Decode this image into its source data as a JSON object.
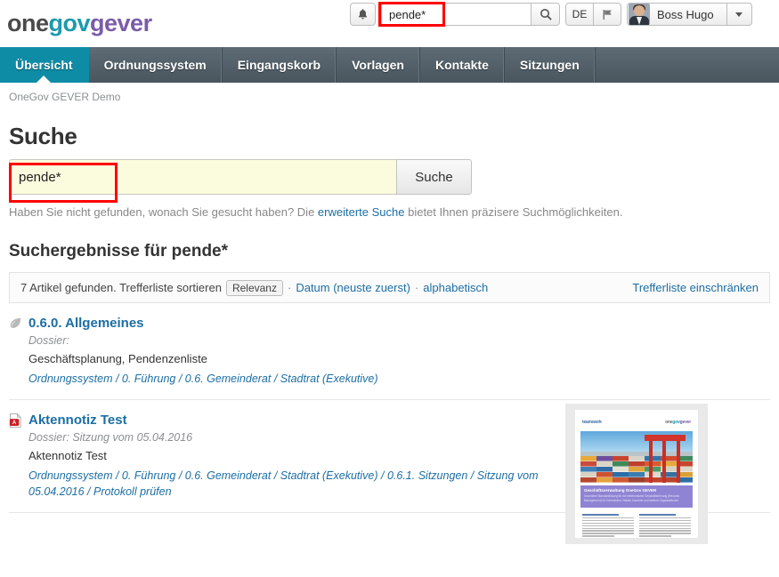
{
  "header": {
    "logo": {
      "part1": "one",
      "part2": "gov",
      "part3": "gever"
    },
    "notifications_icon": "bell-icon",
    "search": {
      "value": "pende*",
      "placeholder": "",
      "button_icon": "search-icon"
    },
    "language": "DE",
    "flag_icon": "flag-icon",
    "user": {
      "name": "Boss Hugo",
      "avatar": "user-avatar"
    },
    "dropdown_icon": "chevron-down-icon"
  },
  "nav": {
    "items": [
      {
        "label": "Übersicht",
        "active": true
      },
      {
        "label": "Ordnungssystem",
        "active": false
      },
      {
        "label": "Eingangskorb",
        "active": false
      },
      {
        "label": "Vorlagen",
        "active": false
      },
      {
        "label": "Kontakte",
        "active": false
      },
      {
        "label": "Sitzungen",
        "active": false
      }
    ]
  },
  "breadcrumb": "OneGov GEVER Demo",
  "main": {
    "page_title": "Suche",
    "search": {
      "value": "pende*",
      "placeholder": "",
      "button_label": "Suche"
    },
    "hint": {
      "before": "Haben Sie nicht gefunden, wonach Sie gesucht haben? Die ",
      "link": "erweiterte Suche",
      "after": " bietet Ihnen präzisere Suchmöglichkeiten."
    },
    "results_title": "Suchergebnisse für pende*",
    "results_bar": {
      "count_text": "7 Artikel gefunden. Trefferliste sortieren",
      "sort_active": "Relevanz",
      "sort_options": [
        "Datum (neuste zuerst)",
        "alphabetisch"
      ],
      "separator": "·",
      "refine_link": "Trefferliste einschränken"
    },
    "results": [
      {
        "icon": "leaf-icon",
        "title": "0.6.0. Allgemeines",
        "meta": "Dossier:",
        "description": "Geschäftsplanung, Pendenzenliste",
        "path": "Ordnungssystem / 0. Führung / 0.6. Gemeinderat / Stadtrat (Exekutive)",
        "has_thumbnail": false
      },
      {
        "icon": "pdf-icon",
        "title": "Aktennotiz Test",
        "meta": "Dossier: Sitzung vom 05.04.2016",
        "description": "Aktennotiz Test",
        "path": "Ordnungssystem / 0. Führung / 0.6. Gemeinderat / Stadtrat (Exekutive) / 0.6.1. Sitzungen / Sitzung vom 05.04.2016 / Protokoll prüfen",
        "has_thumbnail": true,
        "thumbnail": {
          "logo_left": "teamwork",
          "logo_right_a": "one",
          "logo_right_b": "gov",
          "logo_right_c": "gever",
          "banner_title": "Geschäftsverwaltung OneGov GEVER",
          "banner_subtitle": "Innovative Standardlösung für die elektronische Geschäftsführung (Records Management) für Gemeinden, Städte, Kantone und weitere Organisationen."
        }
      }
    ]
  },
  "annotations": {
    "highlight_color": "#ff0000",
    "boxes": [
      "header-search-highlight",
      "main-search-highlight"
    ]
  }
}
